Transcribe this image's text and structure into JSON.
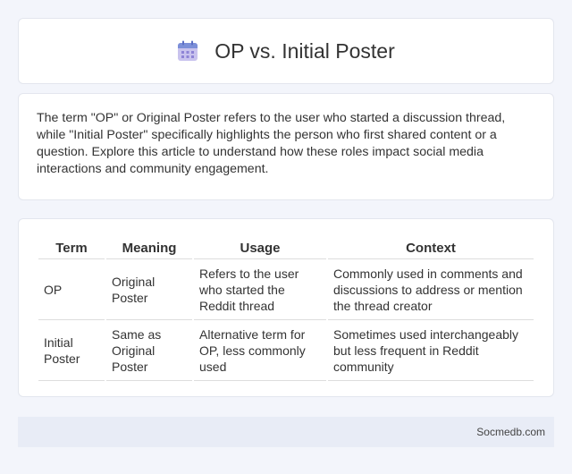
{
  "header": {
    "title": "OP vs. Initial Poster",
    "icon": "calendar-icon"
  },
  "intro": {
    "text": "The term \"OP\" or Original Poster refers to the user who started a discussion thread, while \"Initial Poster\" specifically highlights the person who first shared content or a question. Explore this article to understand how these roles impact social media interactions and community engagement."
  },
  "table": {
    "headers": [
      "Term",
      "Meaning",
      "Usage",
      "Context"
    ],
    "rows": [
      {
        "term": "OP",
        "meaning": "Original Poster",
        "usage": "Refers to the user who started the Reddit thread",
        "context": "Commonly used in comments and discussions to address or mention the thread creator"
      },
      {
        "term": "Initial Poster",
        "meaning": "Same as Original Poster",
        "usage": "Alternative term for OP, less commonly used",
        "context": "Sometimes used interchangeably but less frequent in Reddit community"
      }
    ]
  },
  "footer": {
    "text": "Socmedb.com"
  },
  "colors": {
    "background": "#f3f5fb",
    "icon_header": "#7c8fd8",
    "icon_body": "#c9c3ee",
    "footer_bg": "#e8ecf6"
  }
}
